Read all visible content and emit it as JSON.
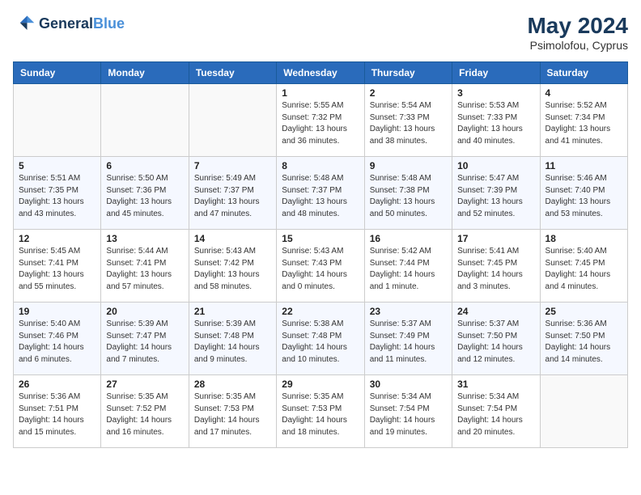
{
  "header": {
    "logo_line1": "General",
    "logo_line2": "Blue",
    "month_year": "May 2024",
    "location": "Psimolofou, Cyprus"
  },
  "weekdays": [
    "Sunday",
    "Monday",
    "Tuesday",
    "Wednesday",
    "Thursday",
    "Friday",
    "Saturday"
  ],
  "weeks": [
    [
      {
        "day": "",
        "info": ""
      },
      {
        "day": "",
        "info": ""
      },
      {
        "day": "",
        "info": ""
      },
      {
        "day": "1",
        "info": "Sunrise: 5:55 AM\nSunset: 7:32 PM\nDaylight: 13 hours\nand 36 minutes."
      },
      {
        "day": "2",
        "info": "Sunrise: 5:54 AM\nSunset: 7:33 PM\nDaylight: 13 hours\nand 38 minutes."
      },
      {
        "day": "3",
        "info": "Sunrise: 5:53 AM\nSunset: 7:33 PM\nDaylight: 13 hours\nand 40 minutes."
      },
      {
        "day": "4",
        "info": "Sunrise: 5:52 AM\nSunset: 7:34 PM\nDaylight: 13 hours\nand 41 minutes."
      }
    ],
    [
      {
        "day": "5",
        "info": "Sunrise: 5:51 AM\nSunset: 7:35 PM\nDaylight: 13 hours\nand 43 minutes."
      },
      {
        "day": "6",
        "info": "Sunrise: 5:50 AM\nSunset: 7:36 PM\nDaylight: 13 hours\nand 45 minutes."
      },
      {
        "day": "7",
        "info": "Sunrise: 5:49 AM\nSunset: 7:37 PM\nDaylight: 13 hours\nand 47 minutes."
      },
      {
        "day": "8",
        "info": "Sunrise: 5:48 AM\nSunset: 7:37 PM\nDaylight: 13 hours\nand 48 minutes."
      },
      {
        "day": "9",
        "info": "Sunrise: 5:48 AM\nSunset: 7:38 PM\nDaylight: 13 hours\nand 50 minutes."
      },
      {
        "day": "10",
        "info": "Sunrise: 5:47 AM\nSunset: 7:39 PM\nDaylight: 13 hours\nand 52 minutes."
      },
      {
        "day": "11",
        "info": "Sunrise: 5:46 AM\nSunset: 7:40 PM\nDaylight: 13 hours\nand 53 minutes."
      }
    ],
    [
      {
        "day": "12",
        "info": "Sunrise: 5:45 AM\nSunset: 7:41 PM\nDaylight: 13 hours\nand 55 minutes."
      },
      {
        "day": "13",
        "info": "Sunrise: 5:44 AM\nSunset: 7:41 PM\nDaylight: 13 hours\nand 57 minutes."
      },
      {
        "day": "14",
        "info": "Sunrise: 5:43 AM\nSunset: 7:42 PM\nDaylight: 13 hours\nand 58 minutes."
      },
      {
        "day": "15",
        "info": "Sunrise: 5:43 AM\nSunset: 7:43 PM\nDaylight: 14 hours\nand 0 minutes."
      },
      {
        "day": "16",
        "info": "Sunrise: 5:42 AM\nSunset: 7:44 PM\nDaylight: 14 hours\nand 1 minute."
      },
      {
        "day": "17",
        "info": "Sunrise: 5:41 AM\nSunset: 7:45 PM\nDaylight: 14 hours\nand 3 minutes."
      },
      {
        "day": "18",
        "info": "Sunrise: 5:40 AM\nSunset: 7:45 PM\nDaylight: 14 hours\nand 4 minutes."
      }
    ],
    [
      {
        "day": "19",
        "info": "Sunrise: 5:40 AM\nSunset: 7:46 PM\nDaylight: 14 hours\nand 6 minutes."
      },
      {
        "day": "20",
        "info": "Sunrise: 5:39 AM\nSunset: 7:47 PM\nDaylight: 14 hours\nand 7 minutes."
      },
      {
        "day": "21",
        "info": "Sunrise: 5:39 AM\nSunset: 7:48 PM\nDaylight: 14 hours\nand 9 minutes."
      },
      {
        "day": "22",
        "info": "Sunrise: 5:38 AM\nSunset: 7:48 PM\nDaylight: 14 hours\nand 10 minutes."
      },
      {
        "day": "23",
        "info": "Sunrise: 5:37 AM\nSunset: 7:49 PM\nDaylight: 14 hours\nand 11 minutes."
      },
      {
        "day": "24",
        "info": "Sunrise: 5:37 AM\nSunset: 7:50 PM\nDaylight: 14 hours\nand 12 minutes."
      },
      {
        "day": "25",
        "info": "Sunrise: 5:36 AM\nSunset: 7:50 PM\nDaylight: 14 hours\nand 14 minutes."
      }
    ],
    [
      {
        "day": "26",
        "info": "Sunrise: 5:36 AM\nSunset: 7:51 PM\nDaylight: 14 hours\nand 15 minutes."
      },
      {
        "day": "27",
        "info": "Sunrise: 5:35 AM\nSunset: 7:52 PM\nDaylight: 14 hours\nand 16 minutes."
      },
      {
        "day": "28",
        "info": "Sunrise: 5:35 AM\nSunset: 7:53 PM\nDaylight: 14 hours\nand 17 minutes."
      },
      {
        "day": "29",
        "info": "Sunrise: 5:35 AM\nSunset: 7:53 PM\nDaylight: 14 hours\nand 18 minutes."
      },
      {
        "day": "30",
        "info": "Sunrise: 5:34 AM\nSunset: 7:54 PM\nDaylight: 14 hours\nand 19 minutes."
      },
      {
        "day": "31",
        "info": "Sunrise: 5:34 AM\nSunset: 7:54 PM\nDaylight: 14 hours\nand 20 minutes."
      },
      {
        "day": "",
        "info": ""
      }
    ]
  ]
}
